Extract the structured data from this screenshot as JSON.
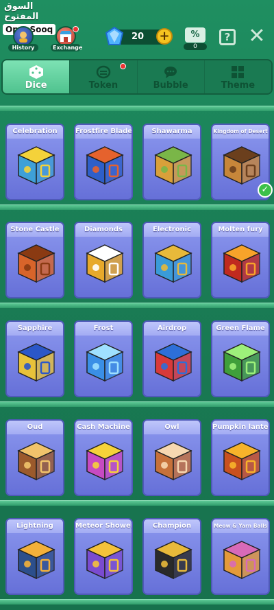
{
  "watermark": {
    "arabic": "السوق المفتوح",
    "latin": "OpenSooq"
  },
  "topbar": {
    "history_label": "History",
    "exchange_label": "Exchange",
    "gems": "20",
    "plus": "+",
    "discount_label": "%",
    "discount_count": "0",
    "help": "?",
    "close": "✕"
  },
  "tabs": [
    {
      "label": "Dice",
      "active": true,
      "icon": "dice-icon"
    },
    {
      "label": "Token",
      "active": false,
      "icon": "token-icon",
      "notify": true
    },
    {
      "label": "Bubble",
      "active": false,
      "icon": "chat-bubble-icon"
    },
    {
      "label": "Theme",
      "active": false,
      "icon": "theme-grid-icon"
    }
  ],
  "dice": [
    {
      "name": "Celebration",
      "color": "#3ea0d8",
      "accent": "#f4d23a",
      "selected": false
    },
    {
      "name": "Frostfire Blade",
      "color": "#2e5fc9",
      "accent": "#e5622d",
      "selected": false
    },
    {
      "name": "Shawarma",
      "color": "#d9a03a",
      "accent": "#7ab648",
      "selected": false
    },
    {
      "name": "Kingdom of Desert",
      "color": "#c7863a",
      "accent": "#6b3f1d",
      "selected": true
    },
    {
      "name": "Stone Castle",
      "color": "#d8642a",
      "accent": "#8a3a12",
      "selected": false
    },
    {
      "name": "Diamonds",
      "color": "#e7a92b",
      "accent": "#ffffff",
      "selected": false
    },
    {
      "name": "Electronic",
      "color": "#3a9bd8",
      "accent": "#e8b93a",
      "selected": false
    },
    {
      "name": "Molten fury",
      "color": "#c02a1f",
      "accent": "#f7a32a",
      "selected": false
    },
    {
      "name": "Sapphire",
      "color": "#e8c23a",
      "accent": "#2b57c8",
      "selected": false
    },
    {
      "name": "Frost",
      "color": "#3a8fe6",
      "accent": "#9fe0ff",
      "selected": false
    },
    {
      "name": "Airdrop",
      "color": "#d83a3a",
      "accent": "#2d6fd8",
      "selected": false
    },
    {
      "name": "Green Flame",
      "color": "#3f9f3a",
      "accent": "#9df07a",
      "selected": false
    },
    {
      "name": "Oud",
      "color": "#9b5a2c",
      "accent": "#f1c36b",
      "selected": false
    },
    {
      "name": "Cash Machine",
      "color": "#c74ac2",
      "accent": "#f5d23a",
      "selected": false
    },
    {
      "name": "Owl",
      "color": "#c6713a",
      "accent": "#f6d7b0",
      "selected": false
    },
    {
      "name": "Pumpkin lantern",
      "color": "#c9501f",
      "accent": "#f7b32a",
      "selected": false
    },
    {
      "name": "Lightning",
      "color": "#2c4f8c",
      "accent": "#f3b03a",
      "selected": false
    },
    {
      "name": "Meteor Shower",
      "color": "#7a4bd0",
      "accent": "#f4c23a",
      "selected": false
    },
    {
      "name": "Champion",
      "color": "#2a2a2a",
      "accent": "#e8b93a",
      "selected": false
    },
    {
      "name": "Meow & Yarn Balls",
      "color": "#e49a3a",
      "accent": "#d86ab8",
      "selected": false
    }
  ]
}
